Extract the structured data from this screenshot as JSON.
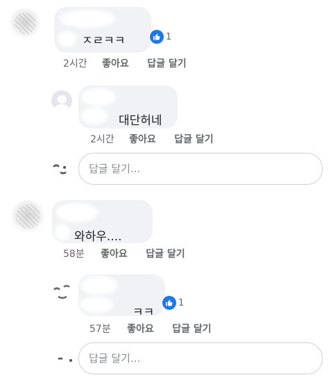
{
  "comments": [
    {
      "text": "ㅈㄹㅋㅋ",
      "time": "2시간",
      "like_label": "좋아요",
      "reply_label": "답글 달기",
      "reaction_count": "1",
      "reactions_icon": "thumbs-up-icon"
    },
    {
      "text": "대단허네",
      "time": "2시간",
      "like_label": "좋아요",
      "reply_label": "답글 달기",
      "reply_input_placeholder": "답글 달기..."
    },
    {
      "text": "와하우....",
      "time": "58분",
      "like_label": "좋아요",
      "reply_label": "답글 달기"
    },
    {
      "text": "ㅋㅋ",
      "time": "57분",
      "like_label": "좋아요",
      "reply_label": "답글 달기",
      "reaction_count": "1",
      "reactions_icon": "thumbs-up-icon",
      "reply_input_placeholder": "답글 달기..."
    }
  ],
  "colors": {
    "like_blue": "#1877f2",
    "bubble_bg": "#f0f2f5",
    "meta_text": "#65676b"
  }
}
